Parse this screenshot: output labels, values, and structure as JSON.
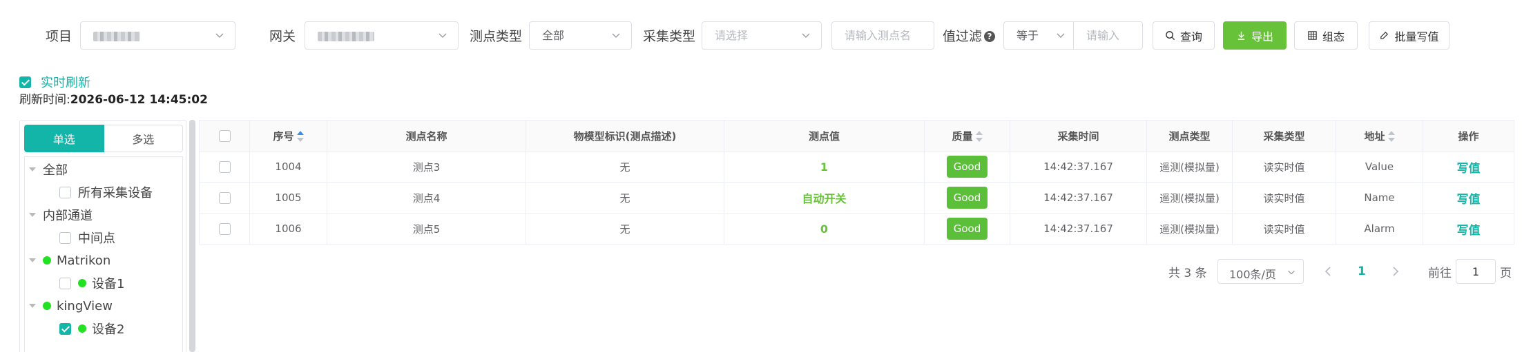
{
  "filters": {
    "project_label": "项目",
    "gateway_label": "网关",
    "point_type_label": "测点类型",
    "point_type_value": "全部",
    "collect_type_label": "采集类型",
    "collect_type_placeholder": "请选择",
    "point_name_placeholder": "请输入测点名",
    "value_filter_label": "值过滤",
    "value_op": "等于",
    "value_placeholder": "请输入",
    "query_label": "查询",
    "export_label": "导出",
    "config_label": "组态",
    "batch_write_label": "批量写值"
  },
  "refresh": {
    "label": "实时刷新",
    "checked": true,
    "time_prefix": "刷新时间:",
    "time_value": "2026-06-12 14:45:02"
  },
  "tree": {
    "single_label": "单选",
    "multi_label": "多选",
    "nodes": [
      {
        "label": "全部"
      },
      {
        "label": "所有采集设备"
      },
      {
        "label": "内部通道"
      },
      {
        "label": "中间点"
      },
      {
        "label": "Matrikon"
      },
      {
        "label": "设备1"
      },
      {
        "label": "kingView"
      },
      {
        "label": "设备2"
      }
    ]
  },
  "table": {
    "headers": [
      "序号",
      "测点名称",
      "物模型标识(测点描述)",
      "测点值",
      "质量",
      "采集时间",
      "测点类型",
      "采集类型",
      "地址",
      "操作"
    ],
    "rows": [
      {
        "id": "1004",
        "name": "测点3",
        "model": "无",
        "value": "1",
        "quality": "Good",
        "time": "14:42:37.167",
        "ptype": "遥测(模拟量)",
        "ctype": "读实时值",
        "addr": "Value",
        "op": "写值"
      },
      {
        "id": "1005",
        "name": "测点4",
        "model": "无",
        "value": "自动开关",
        "quality": "Good",
        "time": "14:42:37.167",
        "ptype": "遥测(模拟量)",
        "ctype": "读实时值",
        "addr": "Name",
        "op": "写值"
      },
      {
        "id": "1006",
        "name": "测点5",
        "model": "无",
        "value": "0",
        "quality": "Good",
        "time": "14:42:37.167",
        "ptype": "遥测(模拟量)",
        "ctype": "读实时值",
        "addr": "Alarm",
        "op": "写值"
      }
    ]
  },
  "pagination": {
    "total": "共 3 条",
    "page_size": "100条/页",
    "current": "1",
    "goto_label": "前往",
    "goto_value": "1",
    "page_suffix": "页"
  },
  "colors": {
    "accent": "#13b5a8",
    "success": "#67c23a"
  }
}
